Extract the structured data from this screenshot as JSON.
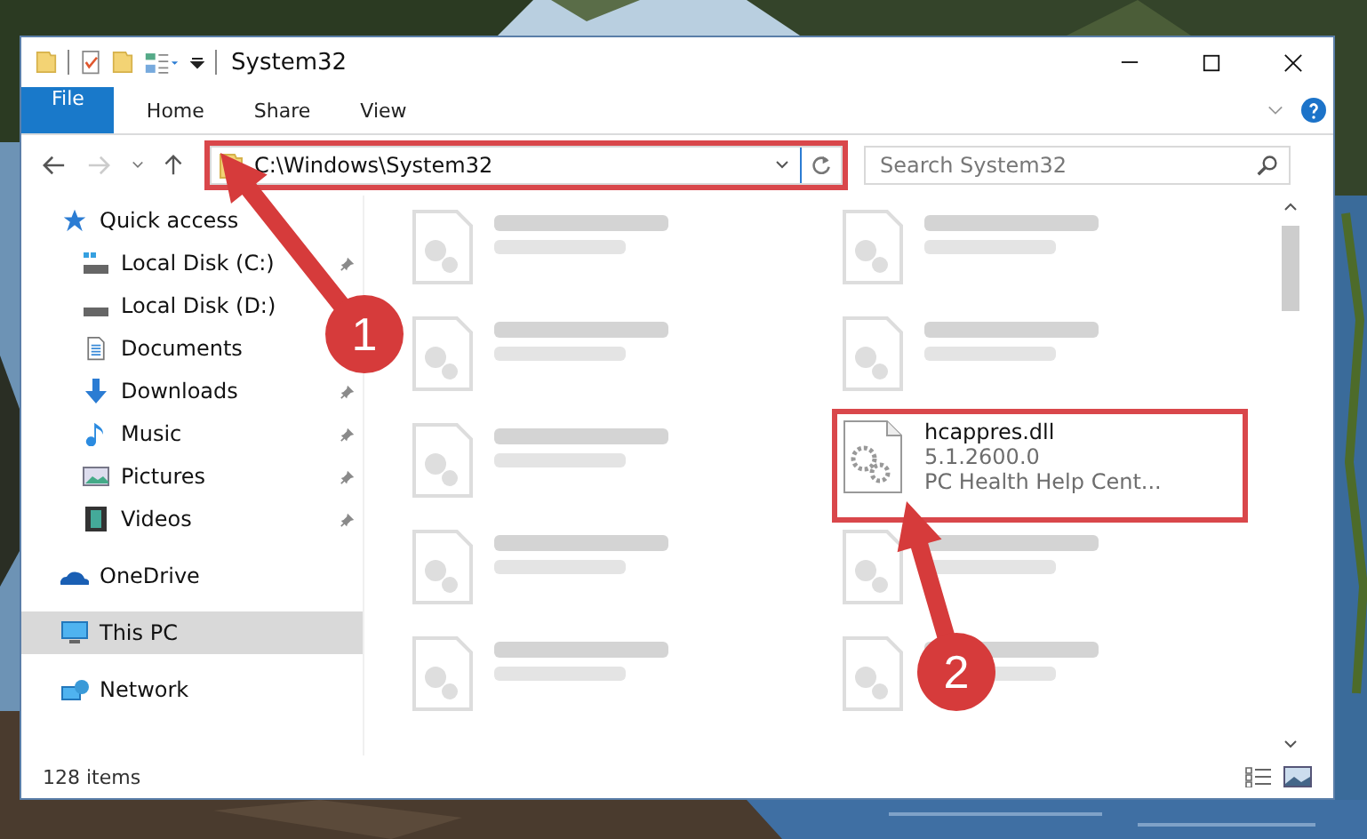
{
  "window": {
    "title": "System32"
  },
  "ribbon_tabs": [
    {
      "label": "File",
      "kind": "file"
    },
    {
      "label": "Home",
      "kind": "tab"
    },
    {
      "label": "Share",
      "kind": "tab"
    },
    {
      "label": "View",
      "kind": "tab"
    }
  ],
  "address_bar": {
    "path": "C:\\Windows\\System32",
    "outlined": true
  },
  "search": {
    "placeholder": "Search System32"
  },
  "sidebar": {
    "items": [
      {
        "label": "Quick access",
        "selected": false,
        "children": [
          {
            "label": "Local Disk (C:)",
            "pinned": true
          },
          {
            "label": "Local Disk (D:)"
          },
          {
            "label": "Documents"
          },
          {
            "label": "Downloads",
            "pinned": true
          },
          {
            "label": "Music",
            "pinned": true
          },
          {
            "label": "Pictures",
            "pinned": true
          },
          {
            "label": "Videos",
            "pinned": true
          }
        ]
      },
      {
        "label": "OneDrive",
        "selected": false
      },
      {
        "label": "This PC",
        "selected": true
      },
      {
        "label": "Network",
        "selected": false
      }
    ]
  },
  "files": [
    {
      "kind": "blurred",
      "outlined": false
    },
    {
      "kind": "blurred",
      "outlined": false
    },
    {
      "kind": "blurred",
      "outlined": false
    },
    {
      "kind": "blurred",
      "outlined": false
    },
    {
      "kind": "blurred",
      "outlined": false
    },
    {
      "kind": "file",
      "name": "hcappres.dll",
      "lines": [
        "5.1.2600.0",
        "PC Health Help Cent..."
      ],
      "outlined": true
    },
    {
      "kind": "blurred",
      "outlined": false
    },
    {
      "kind": "blurred",
      "outlined": false
    },
    {
      "kind": "blurred",
      "outlined": false
    },
    {
      "kind": "blurred",
      "outlined": false
    }
  ],
  "status_bar": {
    "count": "128 items"
  },
  "callouts": [
    {
      "label": "1"
    },
    {
      "label": "2"
    }
  ]
}
